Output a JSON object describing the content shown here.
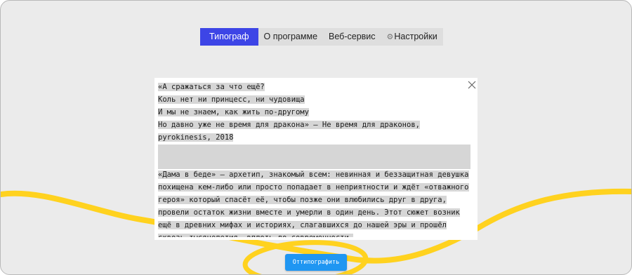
{
  "tabs": [
    {
      "label": "Типограф",
      "active": true
    },
    {
      "label": "О программе",
      "active": false
    },
    {
      "label": "Веб-сервис",
      "active": false
    },
    {
      "label": "Настройки",
      "active": false,
      "icon": "gear-icon"
    }
  ],
  "editor": {
    "lines": [
      "«А сражаться за что ещё?",
      "Коль нет ни принцесс, ни чудовища",
      "И мы не знаем, как жить по-другому",
      "Но давно уже не время для дракона» — Не время для драконов,",
      "pyrokinesis, 2018",
      "",
      "",
      "«Дама в беде» — архетип, знакомый всем: невинная и беззащитная девушка",
      "похищена кем-либо или просто попадает в неприятности и ждёт «отважного",
      "героя» который спасёт её, чтобы позже они влюбились друг в друга,",
      "провели остаток жизни вместе и умерли в один день. Этот сюжет возник",
      "ещё в древних мифах и историях, слагавшихся до нашей эры и прошёл",
      "сквозь тысячелетия, вплоть до современности."
    ],
    "close_icon": "close-icon"
  },
  "submit": {
    "label": "Оттипографить"
  },
  "colors": {
    "background": "#ebebeb",
    "accent_tab": "#3d45e6",
    "button": "#1f96f2",
    "decoration": "#ffd21f",
    "selection": "#d6d6d6"
  }
}
